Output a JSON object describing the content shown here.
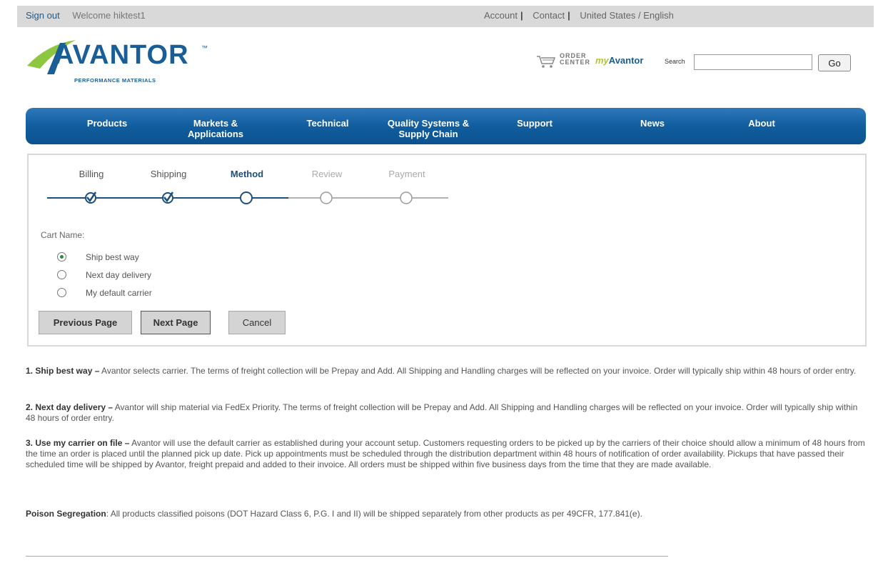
{
  "topbar": {
    "sign_out": "Sign out",
    "welcome": "Welcome hiktest1",
    "account": "Account",
    "contact": "Contact",
    "region": "United States / English",
    "separator": "|"
  },
  "logo": {
    "name": "AVANTOR",
    "tagline": "PERFORMANCE MATERIALS",
    "trademark": "™"
  },
  "utility": {
    "order_center_line1": "ORDER",
    "order_center_line2": "CENTER",
    "my_prefix": "my",
    "my_suffix": "Avantor",
    "search_label": "Search",
    "search_value": "",
    "go_label": "Go"
  },
  "nav": {
    "items": [
      {
        "label": "Products"
      },
      {
        "label": "Markets &\nApplications"
      },
      {
        "label": "Technical"
      },
      {
        "label": "Quality Systems &\nSupply Chain"
      },
      {
        "label": "Support"
      },
      {
        "label": "News"
      },
      {
        "label": "About"
      }
    ]
  },
  "steps": [
    {
      "label": "Billing",
      "state": "done"
    },
    {
      "label": "Shipping",
      "state": "done"
    },
    {
      "label": "Method",
      "state": "current"
    },
    {
      "label": "Review",
      "state": "future"
    },
    {
      "label": "Payment",
      "state": "future"
    }
  ],
  "form": {
    "cart_name_label": "Cart Name:",
    "options": [
      {
        "label": "Ship best way",
        "checked": true
      },
      {
        "label": "Next day delivery",
        "checked": false
      },
      {
        "label": "My default carrier",
        "checked": false
      }
    ],
    "buttons": {
      "previous": "Previous Page",
      "next": "Next Page",
      "cancel": "Cancel"
    }
  },
  "info": {
    "p1_title": "1. Ship best way –",
    "p1_text": " Avantor selects carrier. The terms of freight collection will be Prepay and Add. All Shipping and Handling charges will be reflected on your invoice. Order will typically ship within 48 hours of order entry.",
    "p2_title": "2. Next day delivery –",
    "p2_text": " Avantor will ship material via FedEx Priority. The terms of freight collection will be Prepay and Add. All Shipping and Handling charges will be reflected on your invoice. Order will typically ship within 48 hours of order entry.",
    "p3_title": "3. Use my carrier on file –",
    "p3_text": " Avantor will use the default carrier as established during your account setup. Customers requesting orders to be picked up by the carriers of their choice should allow a minimum of 48 hours from the time an order is placed until the planned pick up date. Pick up appointments must be scheduled through the distribution department within 48 hours of notification of order availability. Pickups that have passed their scheduled time will be shipped by Avantor, freight prepaid and added to their invoice. All orders must be shipped within five business days from the time that they are made available.",
    "p4_title": "Poison Segregation",
    "p4_text": ": All products classified poisons (DOT Hazard Class 6, P.G. I and II) will be shipped separately from other products as per 49CFR, 177.841(e)."
  },
  "colors": {
    "nav_blue": "#115d9e",
    "brand_blue": "#1a5e98",
    "brand_green": "#8dc63f",
    "radio_green": "#2e8b3e"
  }
}
